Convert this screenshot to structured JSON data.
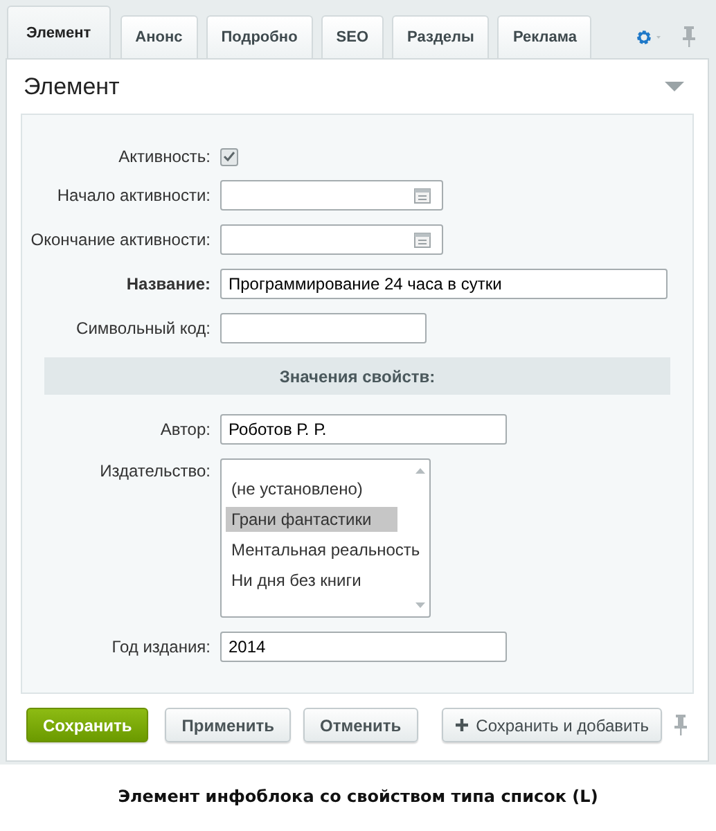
{
  "tabs": [
    {
      "label": "Элемент",
      "selected": true
    },
    {
      "label": "Анонс",
      "selected": false
    },
    {
      "label": "Подробно",
      "selected": false
    },
    {
      "label": "SEO",
      "selected": false
    },
    {
      "label": "Разделы",
      "selected": false
    },
    {
      "label": "Реклама",
      "selected": false
    }
  ],
  "panel": {
    "title": "Элемент"
  },
  "fields": [
    {
      "kind": "checkbox",
      "label": "Активность:",
      "required": false,
      "checked": true
    },
    {
      "kind": "date",
      "label": "Начало активности:",
      "required": false
    },
    {
      "kind": "date",
      "label": "Окончание активности:",
      "required": false
    },
    {
      "kind": "text",
      "label": "Название:",
      "required": true,
      "value": "Программирование 24 часа в сутки"
    },
    {
      "kind": "text",
      "label": "Символьный код:",
      "required": false
    },
    {
      "kind": "section",
      "label": "Значения свойств:"
    },
    {
      "kind": "text",
      "label": "Автор:",
      "required": false,
      "value": "Роботов Р. Р."
    },
    {
      "kind": "listbox",
      "label": "Издательство:",
      "required": false,
      "options": [
        {
          "label": "(не установлено)",
          "selected": false
        },
        {
          "label": "Грани фантастики",
          "selected": true
        },
        {
          "label": "Ментальная реальность",
          "selected": false
        },
        {
          "label": "Ни дня без книги",
          "selected": false
        }
      ]
    },
    {
      "kind": "text",
      "label": "Год издания:",
      "required": false,
      "value": "2014"
    }
  ],
  "buttons": [
    {
      "label": "Сохранить",
      "kind": "primary"
    },
    {
      "label": "Применить",
      "kind": "normal"
    },
    {
      "label": "Отменить",
      "kind": "normal"
    },
    {
      "label": "Сохранить и добавить",
      "kind": "add"
    }
  ],
  "caption": "Элемент инфоблока со свойством типа список (L)"
}
